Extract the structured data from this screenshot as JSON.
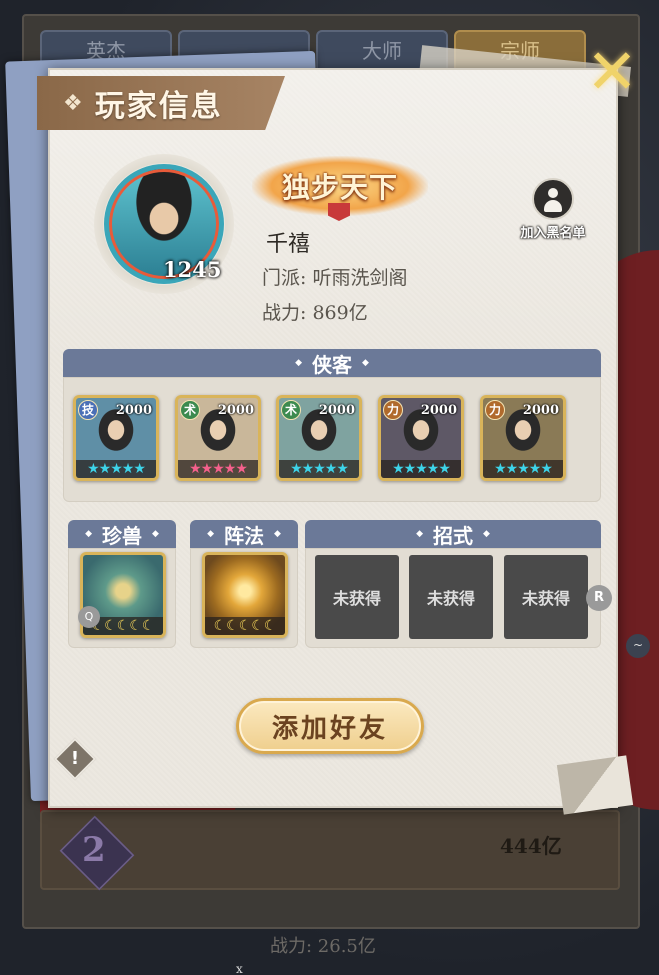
{
  "background": {
    "tabs": [
      {
        "label": "英杰",
        "active": false
      },
      {
        "label": "",
        "active": false
      },
      {
        "label": "大师",
        "active": false
      },
      {
        "label": "宗师",
        "active": true
      }
    ],
    "rank_number": "2",
    "rank_power": "444亿",
    "bottom_power": "战力: 26.5亿",
    "bottom_marker": "x"
  },
  "dialog": {
    "title": "玩家信息",
    "title_icon": "diamond-ornament-icon",
    "close_icon": "close-x-icon",
    "player": {
      "level": "1245",
      "title_badge": "独步天下",
      "name": "千禧",
      "sect": "门派: 听雨洗剑阁",
      "power": "战力: 869亿"
    },
    "blacklist_label": "加入黑名单",
    "sections": {
      "heroes": "侠客",
      "beast": "珍兽",
      "formation": "阵法",
      "moves": "招式"
    },
    "heroes": [
      {
        "type": "技",
        "type_color": "#4a6fb6",
        "power": "2000",
        "stars": 5,
        "star_color": "cyan",
        "bg": "#5f8fa6"
      },
      {
        "type": "术",
        "type_color": "#3c8a4f",
        "power": "2000",
        "stars": 5,
        "star_color": "pink",
        "bg": "#c9b79a"
      },
      {
        "type": "术",
        "type_color": "#3c8a4f",
        "power": "2000",
        "stars": 5,
        "star_color": "cyan",
        "bg": "#7fa3a0"
      },
      {
        "type": "力",
        "type_color": "#b06a2c",
        "power": "2000",
        "stars": 5,
        "star_color": "cyan",
        "bg": "#5e5866"
      },
      {
        "type": "力",
        "type_color": "#b06a2c",
        "power": "2000",
        "stars": 5,
        "star_color": "cyan",
        "bg": "#8a7a56"
      }
    ],
    "beast_moons": 5,
    "formation_moons": 5,
    "locked_label": "未获得",
    "side_r": "R",
    "side_q": "Q",
    "side_tilde": "~",
    "add_friend": "添加好友",
    "warn_mark": "!"
  }
}
